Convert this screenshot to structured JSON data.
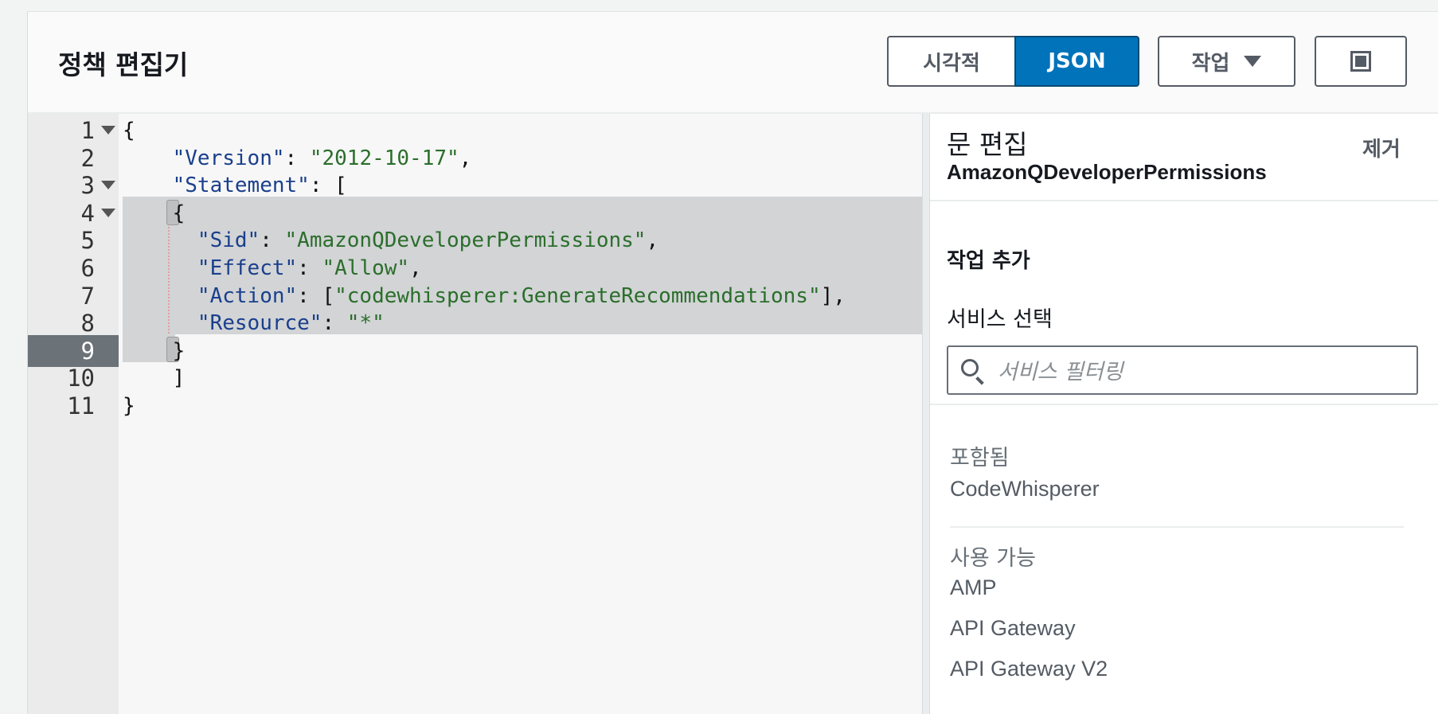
{
  "header": {
    "title": "정책 편집기",
    "view_toggle": [
      "시각적",
      "JSON"
    ],
    "actions_label": "작업",
    "fullscreen_icon": "fullscreen-icon"
  },
  "editor": {
    "active_line": 9,
    "lines": [
      {
        "n": "1",
        "code": "{"
      },
      {
        "n": "2",
        "code": "    \"Version\": \"2012-10-17\","
      },
      {
        "n": "3",
        "code": "    \"Statement\": ["
      },
      {
        "n": "4",
        "code": "    {"
      },
      {
        "n": "5",
        "code": "      \"Sid\": \"AmazonQDeveloperPermissions\","
      },
      {
        "n": "6",
        "code": "      \"Effect\": \"Allow\","
      },
      {
        "n": "7",
        "code": "      \"Action\": [\"codewhisperer:GenerateRecommendations\"],"
      },
      {
        "n": "8",
        "code": "      \"Resource\": \"*\""
      },
      {
        "n": "9",
        "code": "    }"
      },
      {
        "n": "10",
        "code": "    ]"
      },
      {
        "n": "11",
        "code": "}"
      }
    ]
  },
  "side": {
    "title": "문 편집",
    "statement_name": "AmazonQDeveloperPermissions",
    "remove_label": "제거",
    "add_actions_title": "작업 추가",
    "service_select_label": "서비스 선택",
    "search_placeholder": "서비스 필터링",
    "included_title": "포함됨",
    "included": [
      "CodeWhisperer"
    ],
    "available_title": "사용 가능",
    "available": [
      "AMP",
      "API Gateway",
      "API Gateway V2"
    ]
  }
}
